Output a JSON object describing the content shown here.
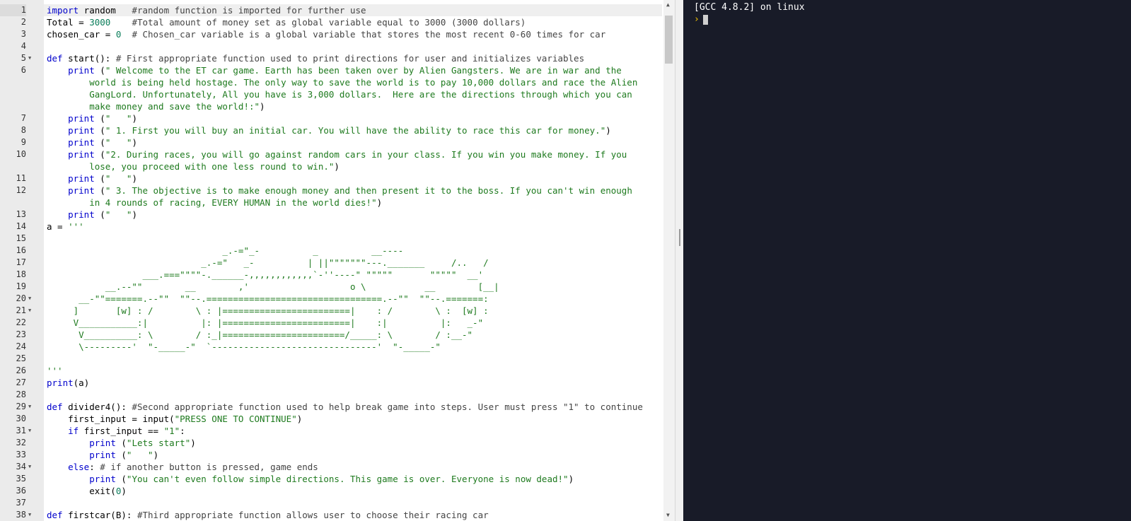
{
  "editor": {
    "lines": [
      {
        "n": "1",
        "fold": false,
        "active": true,
        "html": "<span class=\"kw\">import</span> random   <span class=\"cm\">#random function is imported for further use</span>"
      },
      {
        "n": "2",
        "fold": false,
        "html": "Total = <span class=\"num\">3000</span>    <span class=\"cm\">#Total amount of money set as global variable equal to 3000 (3000 dollars)</span>"
      },
      {
        "n": "3",
        "fold": false,
        "html": "chosen_car = <span class=\"num\">0</span>  <span class=\"cm\"># Chosen_car variable is a global variable that stores the most recent 0-60 times for car</span>"
      },
      {
        "n": "4",
        "fold": false,
        "html": ""
      },
      {
        "n": "5",
        "fold": true,
        "html": "<span class=\"kw\">def</span> start(): <span class=\"cm\"># First appropriate function used to print directions for user and initializes variables</span>"
      },
      {
        "n": "6",
        "fold": false,
        "wrap": true,
        "html": "    <span class=\"kw\">print</span> (<span class=\"str\">\" Welcome to the ET car game. Earth has been taken over by Alien Gangsters. We are in war and the\n        world is being held hostage. The only way to save the world is to pay 10,000 dollars and race the Alien\n        GangLord. Unfortunately, All you have is 3,000 dollars.  Here are the directions through which you can\n        make money and save the world!:\"</span>)"
      },
      {
        "n": "7",
        "fold": false,
        "html": "    <span class=\"kw\">print</span> (<span class=\"str\">\"   \"</span>)"
      },
      {
        "n": "8",
        "fold": false,
        "html": "    <span class=\"kw\">print</span> (<span class=\"str\">\" 1. First you will buy an initial car. You will have the ability to race this car for money.\"</span>)"
      },
      {
        "n": "9",
        "fold": false,
        "html": "    <span class=\"kw\">print</span> (<span class=\"str\">\"   \"</span>)"
      },
      {
        "n": "10",
        "fold": false,
        "wrap": true,
        "html": "    <span class=\"kw\">print</span> (<span class=\"str\">\"2. During races, you will go against random cars in your class. If you win you make money. If you\n        lose, you proceed with one less round to win.\"</span>)"
      },
      {
        "n": "11",
        "fold": false,
        "html": "    <span class=\"kw\">print</span> (<span class=\"str\">\"   \"</span>)"
      },
      {
        "n": "12",
        "fold": false,
        "wrap": true,
        "html": "    <span class=\"kw\">print</span> (<span class=\"str\">\" 3. The objective is to make enough money and then present it to the boss. If you can't win enough\n        in 4 rounds of racing, EVERY HUMAN in the world dies!\"</span>)"
      },
      {
        "n": "13",
        "fold": false,
        "html": "    <span class=\"kw\">print</span> (<span class=\"str\">\"   \"</span>)"
      },
      {
        "n": "14",
        "fold": false,
        "html": "a = <span class=\"str\">'''</span>"
      },
      {
        "n": "15",
        "fold": false,
        "ascii": true,
        "html": ""
      },
      {
        "n": "16",
        "fold": false,
        "ascii": true,
        "html": "                                 _.-=\"_-          _          __----"
      },
      {
        "n": "17",
        "fold": false,
        "ascii": true,
        "html": "                             _.-=\"   _-          | ||\"\"\"\"\"\"\"---._______     /..   /"
      },
      {
        "n": "18",
        "fold": false,
        "ascii": true,
        "html": "                  ___.===\"\"\"\"-.______-,,,,,,,,,,,,`-''----\" \"\"\"\"\"       \"\"\"\"\"  __'"
      },
      {
        "n": "19",
        "fold": false,
        "ascii": true,
        "html": "           __.--\"\"        __        ,'                   o \\           __        [__|"
      },
      {
        "n": "20",
        "fold": true,
        "ascii": true,
        "html": "      __-\"\"=======.--\"\"  \"\"--.=================================.--\"\"  \"\"--.=======:"
      },
      {
        "n": "21",
        "fold": true,
        "ascii": true,
        "html": "     ]       [w] : /        \\ : |========================|    : /        \\ :  [w] :"
      },
      {
        "n": "22",
        "fold": false,
        "ascii": true,
        "html": "     V___________:|          |: |========================|    :|          |:   _-\""
      },
      {
        "n": "23",
        "fold": false,
        "ascii": true,
        "html": "      V__________: \\        / :_|=======================/_____: \\        / :__-\""
      },
      {
        "n": "24",
        "fold": false,
        "ascii": true,
        "html": "      \\---------'  \"-_____-\"  `-------------------------------'  \"-_____-\""
      },
      {
        "n": "25",
        "fold": false,
        "html": ""
      },
      {
        "n": "26",
        "fold": false,
        "html": "<span class=\"str\">'''</span>"
      },
      {
        "n": "27",
        "fold": false,
        "html": "<span class=\"kw\">print</span>(a)"
      },
      {
        "n": "28",
        "fold": false,
        "html": ""
      },
      {
        "n": "29",
        "fold": true,
        "html": "<span class=\"kw\">def</span> divider4(): <span class=\"cm\">#Second appropriate function used to help break game into steps. User must press \"1\" to continue</span>"
      },
      {
        "n": "30",
        "fold": false,
        "html": "    first_input = input(<span class=\"str\">\"PRESS ONE TO CONTINUE\"</span>)"
      },
      {
        "n": "31",
        "fold": true,
        "html": "    <span class=\"kw\">if</span> first_input == <span class=\"str\">\"1\"</span>:"
      },
      {
        "n": "32",
        "fold": false,
        "html": "        <span class=\"kw\">print</span> (<span class=\"str\">\"Lets start\"</span>)"
      },
      {
        "n": "33",
        "fold": false,
        "html": "        <span class=\"kw\">print</span> (<span class=\"str\">\"   \"</span>)"
      },
      {
        "n": "34",
        "fold": true,
        "html": "    <span class=\"kw\">else</span>: <span class=\"cm\"># if another button is pressed, game ends</span>"
      },
      {
        "n": "35",
        "fold": false,
        "html": "        <span class=\"kw\">print</span> (<span class=\"str\">\"You can't even follow simple directions. This game is over. Everyone is now dead!\"</span>)"
      },
      {
        "n": "36",
        "fold": false,
        "html": "        exit(<span class=\"num\">0</span>)"
      },
      {
        "n": "37",
        "fold": false,
        "html": ""
      },
      {
        "n": "38",
        "fold": true,
        "html": "<span class=\"kw\">def</span> firstcar(B): <span class=\"cm\">#Third appropriate function allows user to choose their racing car</span>"
      }
    ]
  },
  "console": {
    "version_line": "[GCC 4.8.2] on linux",
    "prompt": "›"
  }
}
